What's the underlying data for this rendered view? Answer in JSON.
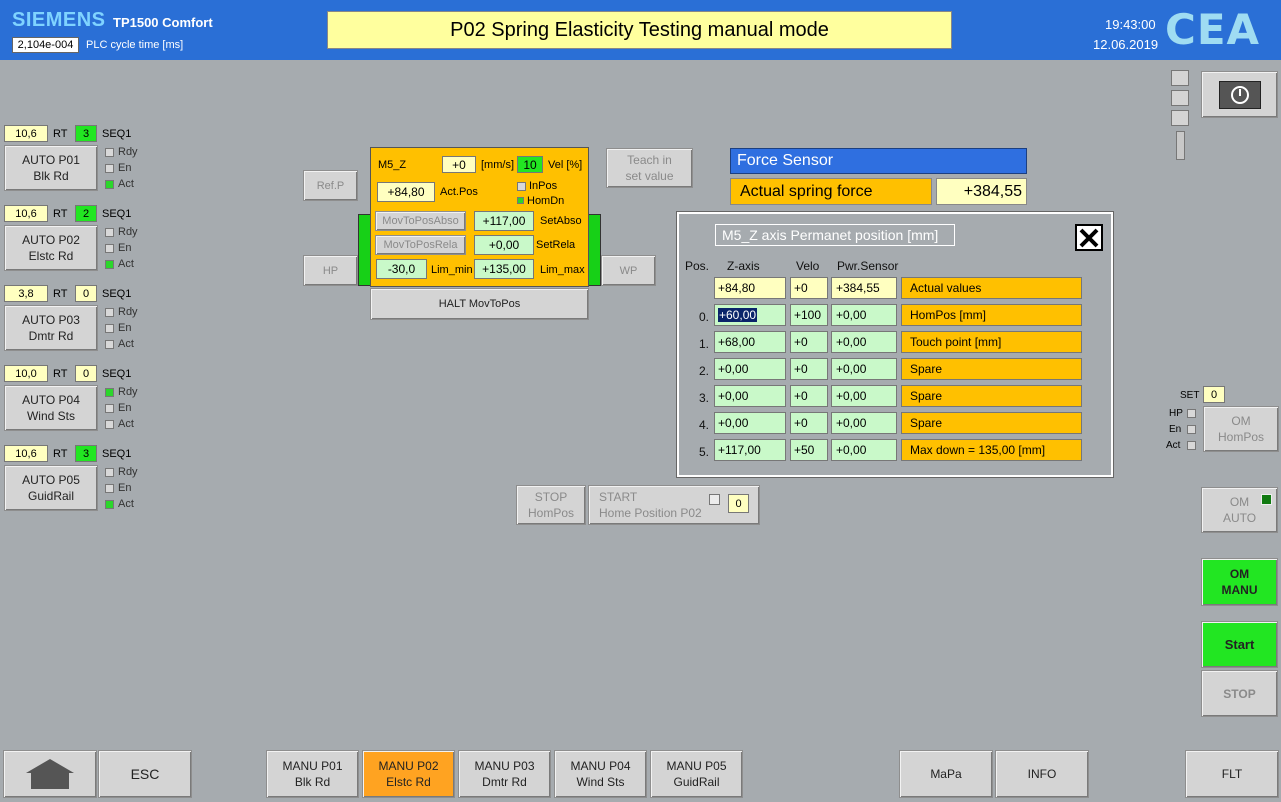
{
  "header": {
    "brand": "SIEMENS",
    "model": "TP1500 Comfort",
    "cycle_value": "2,104e-004",
    "cycle_label": "PLC cycle time [ms]",
    "title": "P02 Spring Elasticity Testing manual mode",
    "time": "19:43:00",
    "date": "12.06.2019",
    "logo": "CEA"
  },
  "stations": [
    {
      "value": "10,6",
      "rt": "RT",
      "seq_num": "3",
      "seq": "SEQ1",
      "btn1": "AUTO P01",
      "btn2": "Blk Rd",
      "rdy": "Rdy",
      "en": "En",
      "act": "Act"
    },
    {
      "value": "10,6",
      "rt": "RT",
      "seq_num": "2",
      "seq": "SEQ1",
      "btn1": "AUTO P02",
      "btn2": "Elstc Rd",
      "rdy": "Rdy",
      "en": "En",
      "act": "Act"
    },
    {
      "value": "3,8",
      "rt": "RT",
      "seq_num": "0",
      "seq": "SEQ1",
      "btn1": "AUTO P03",
      "btn2": "Dmtr Rd",
      "rdy": "Rdy",
      "en": "En",
      "act": "Act"
    },
    {
      "value": "10,0",
      "rt": "RT",
      "seq_num": "0",
      "seq": "SEQ1",
      "btn1": "AUTO P04",
      "btn2": "Wind Sts",
      "rdy": "Rdy",
      "en": "En",
      "act": "Act"
    },
    {
      "value": "10,6",
      "rt": "RT",
      "seq_num": "3",
      "seq": "SEQ1",
      "btn1": "AUTO P05",
      "btn2": "GuidRail",
      "rdy": "Rdy",
      "en": "En",
      "act": "Act"
    }
  ],
  "axis": {
    "refp": "Ref.P",
    "hp": "HP",
    "wp": "WP",
    "name": "M5_Z",
    "vel_value": "+0",
    "vel_unit": "[mm/s]",
    "vel_pct": "10",
    "vel_pct_label": "Vel [%]",
    "act_pos": "+84,80",
    "act_pos_label": "Act.Pos",
    "inpos": "InPos",
    "homdn": "HomDn",
    "mov_abso": "MovToPosAbso",
    "set_abso": "+117,00",
    "set_abso_label": "SetAbso",
    "mov_rela": "MovToPosRela",
    "set_rela": "+0,00",
    "set_rela_label": "SetRela",
    "lim_min": "-30,0",
    "lim_min_label": "Lim_min",
    "lim_max": "+135,00",
    "lim_max_label": "Lim_max",
    "halt": "HALT MovToPos",
    "teach1": "Teach in",
    "teach2": "set value"
  },
  "force": {
    "title": "Force Sensor",
    "label": "Actual spring force",
    "value": "+384,55"
  },
  "popup": {
    "title": "M5_Z axis Permanet position [mm]",
    "col_pos": "Pos.",
    "col_z": "Z-axis",
    "col_velo": "Velo",
    "col_pwr": "Pwr.Sensor",
    "rows": [
      {
        "idx": "",
        "z": "+84,80",
        "velo": "+0",
        "pwr": "+384,55",
        "desc": "Actual values"
      },
      {
        "idx": "0.",
        "z": "+60,00",
        "velo": "+100",
        "pwr": "+0,00",
        "desc": "HomPos [mm]"
      },
      {
        "idx": "1.",
        "z": "+68,00",
        "velo": "+0",
        "pwr": "+0,00",
        "desc": "Touch point [mm]"
      },
      {
        "idx": "2.",
        "z": "+0,00",
        "velo": "+0",
        "pwr": "+0,00",
        "desc": "Spare"
      },
      {
        "idx": "3.",
        "z": "+0,00",
        "velo": "+0",
        "pwr": "+0,00",
        "desc": "Spare"
      },
      {
        "idx": "4.",
        "z": "+0,00",
        "velo": "+0",
        "pwr": "+0,00",
        "desc": "Spare"
      },
      {
        "idx": "5.",
        "z": "+117,00",
        "velo": "+50",
        "pwr": "+0,00",
        "desc": "Max down = 135,00 [mm]"
      }
    ]
  },
  "homing": {
    "stop1": "STOP",
    "stop2": "HomPos",
    "start1": "START",
    "start2": "Home Position P02",
    "count": "0"
  },
  "right": {
    "set_label": "SET",
    "set_value": "0",
    "hp": "HP",
    "en": "En",
    "act": "Act",
    "om_hompos1": "OM",
    "om_hompos2": "HomPos",
    "om_auto1": "OM",
    "om_auto2": "AUTO",
    "om_manu1": "OM",
    "om_manu2": "MANU",
    "start": "Start",
    "stop": "STOP"
  },
  "footer": {
    "esc": "ESC",
    "tabs": [
      {
        "l1": "MANU P01",
        "l2": "Blk Rd"
      },
      {
        "l1": "MANU P02",
        "l2": "Elstc Rd"
      },
      {
        "l1": "MANU P03",
        "l2": "Dmtr Rd"
      },
      {
        "l1": "MANU P04",
        "l2": "Wind Sts"
      },
      {
        "l1": "MANU P05",
        "l2": "GuidRail"
      }
    ],
    "mapa": "MaPa",
    "info": "INFO",
    "flt": "FLT"
  },
  "colors": {
    "header_blue": "#2a6fd6",
    "axis_orange": "#ffc000",
    "active_green": "#22e622",
    "selected_tab": "#ffa321"
  }
}
